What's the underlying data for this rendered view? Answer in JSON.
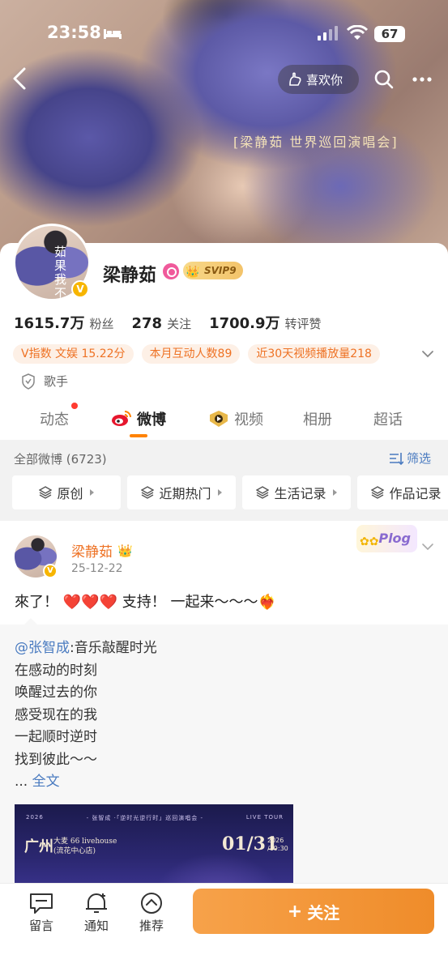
{
  "status_bar": {
    "time": "23:58",
    "battery": "67"
  },
  "header": {
    "like_label": "喜欢你",
    "cover_caption": "[梁静茹 世界巡回演唱会]"
  },
  "profile": {
    "avatar_text": "茹果我不",
    "name": "梁静茹",
    "svip": "SVIP9",
    "verified_badge": "V",
    "stats": [
      {
        "num": "1615.7万",
        "label": "粉丝"
      },
      {
        "num": "278",
        "label": "关注"
      },
      {
        "num": "1700.9万",
        "label": "转评赞"
      }
    ],
    "tags": [
      "V指数 文娱 15.22分",
      "本月互动人数89",
      "近30天视频播放量218"
    ],
    "occupation": "歌手"
  },
  "tabs": [
    {
      "label": "动态"
    },
    {
      "label": "微博"
    },
    {
      "label": "视频"
    },
    {
      "label": "相册"
    },
    {
      "label": "超话"
    }
  ],
  "filter": {
    "all_label": "全部微博 (6723)",
    "filter_label": "筛选",
    "categories": [
      "原创",
      "近期热门",
      "生活记录",
      "作品记录"
    ]
  },
  "post": {
    "author": "梁静茹",
    "date": "25-12-22",
    "badge": "Plog",
    "text_before": "來了！",
    "hearts": "❤️❤️❤️",
    "text_after": "支持！  一起来～～～❤️‍🔥",
    "repost": {
      "mention": "@张智成",
      "first_line": ":音乐敲醒时光",
      "lines": [
        "在感动的时刻",
        "唤醒过去的你",
        "感受现在的我",
        "一起顺时逆时",
        "找到彼此～～"
      ],
      "ellipsis": "... ",
      "more": "全文"
    },
    "poster": {
      "year": "2026",
      "title": "- 张智成 ·「逆时光逆行时」巡回演唱会 -",
      "tour": "LIVE TOUR",
      "city": "广州",
      "venue_line1": "大麦 66 livehouse",
      "venue_line2": "(流花中心店)",
      "date": "01/31",
      "date_year": "2026",
      "date_time": "/19:30"
    }
  },
  "bottom_bar": {
    "comment": "留言",
    "notify": "通知",
    "recommend": "推荐",
    "follow": "关注"
  }
}
